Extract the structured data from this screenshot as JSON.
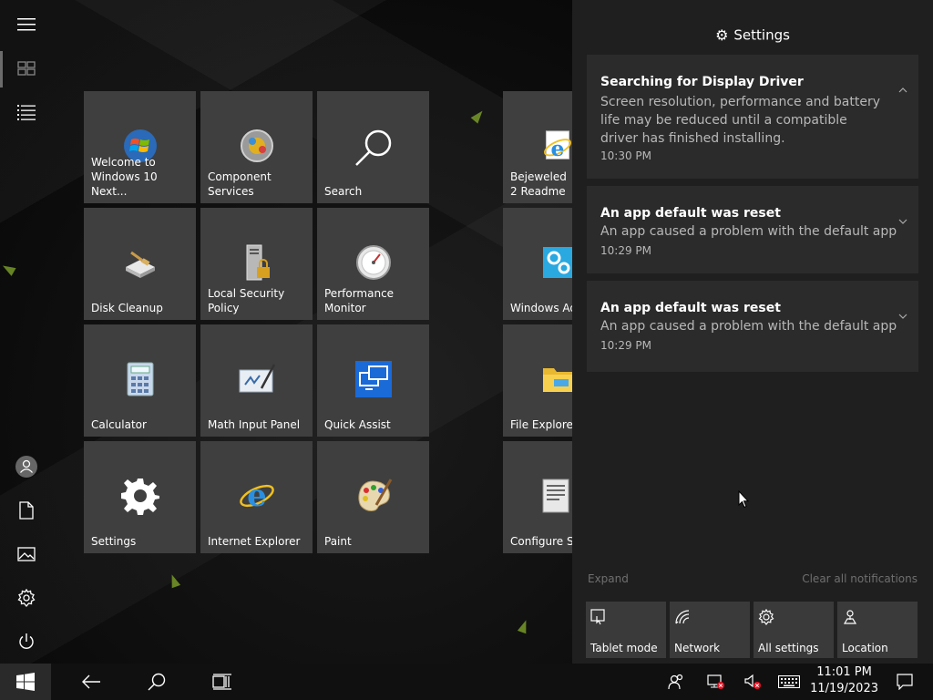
{
  "tiles": [
    {
      "label": "Welcome to Windows 10 Next...",
      "icon": "windows-logo-icon"
    },
    {
      "label": "Component Services",
      "icon": "component-services-icon"
    },
    {
      "label": "Search",
      "icon": "search-icon"
    },
    {
      "label": "Bejeweled 2 Readme",
      "icon": "internet-explorer-icon"
    },
    {
      "label": "Disk Cleanup",
      "icon": "disk-cleanup-icon"
    },
    {
      "label": "Local Security Policy",
      "icon": "security-policy-icon"
    },
    {
      "label": "Performance Monitor",
      "icon": "performance-monitor-icon"
    },
    {
      "label": "Windows Administrative",
      "icon": "admin-tools-icon"
    },
    {
      "label": "Calculator",
      "icon": "calculator-icon"
    },
    {
      "label": "Math Input Panel",
      "icon": "math-input-icon"
    },
    {
      "label": "Quick Assist",
      "icon": "quick-assist-icon"
    },
    {
      "label": "File Explorer",
      "icon": "folder-icon"
    },
    {
      "label": "Settings",
      "icon": "gear-icon"
    },
    {
      "label": "Internet Explorer",
      "icon": "internet-explorer-icon"
    },
    {
      "label": "Paint",
      "icon": "paint-palette-icon"
    },
    {
      "label": "Configure Sta",
      "icon": "configure-icon"
    }
  ],
  "action_center": {
    "title": "Settings",
    "notifications": [
      {
        "title": "Searching for Display Driver",
        "body": "Screen resolution, performance and battery life may be reduced until a compatible driver has finished installing.",
        "time": "10:30 PM"
      },
      {
        "title": "An app default was reset",
        "body": "An app caused a problem with the default app",
        "time": "10:29 PM"
      },
      {
        "title": "An app default was reset",
        "body": "An app caused a problem with the default app",
        "time": "10:29 PM"
      }
    ],
    "expand_label": "Expand",
    "clear_label": "Clear all notifications",
    "quick_actions": [
      {
        "label": "Tablet mode",
        "icon": "tablet-mode-icon"
      },
      {
        "label": "Network",
        "icon": "network-icon"
      },
      {
        "label": "All settings",
        "icon": "gear-icon"
      },
      {
        "label": "Location",
        "icon": "location-icon"
      }
    ]
  },
  "taskbar": {
    "time": "11:01 PM",
    "date": "11/19/2023"
  },
  "colors": {
    "tile": "#3f3f3f",
    "action_center_bg": "#1f1f1f",
    "notification_bg": "#2b2b2b",
    "taskbar_bg": "#101010",
    "error_red": "#e81123",
    "accent_green": "#7ea32a"
  }
}
